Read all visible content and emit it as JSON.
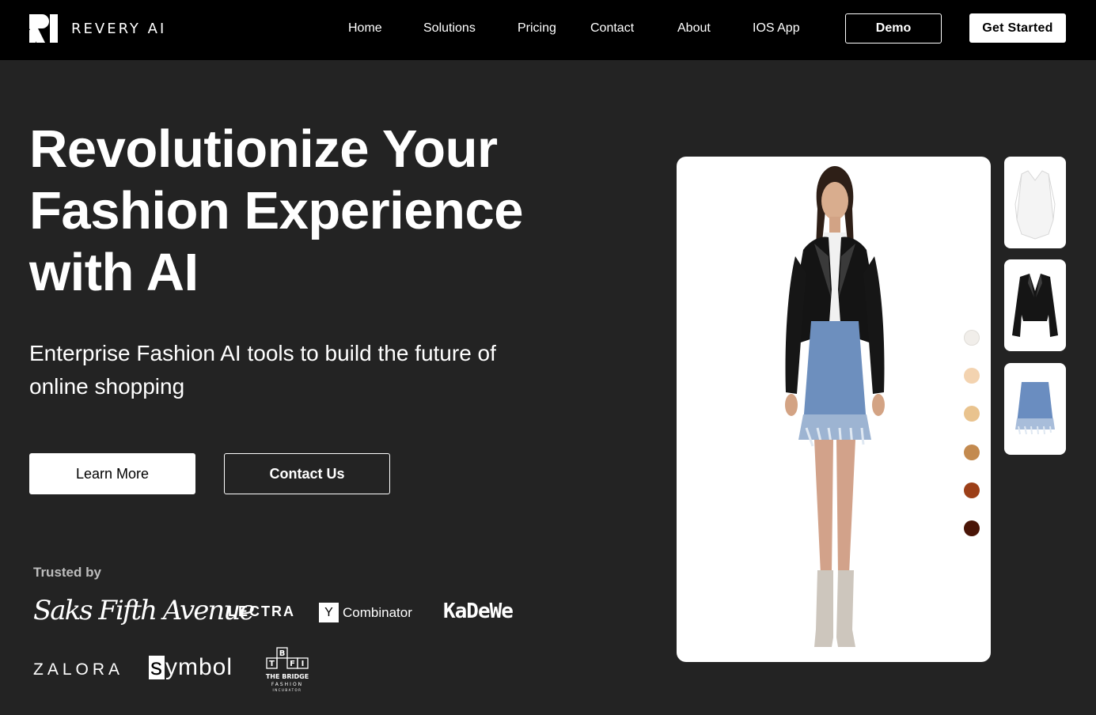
{
  "nav": {
    "brand": "REVERY AI",
    "links": [
      "Home",
      "Solutions",
      "Pricing",
      "Contact",
      "About",
      "IOS App"
    ],
    "demo_label": "Demo",
    "get_started_label": "Get Started"
  },
  "hero": {
    "headline": [
      "Revolutionize Your",
      "Fashion Experience",
      "with AI"
    ],
    "subline": [
      "Enterprise Fashion AI tools to build the future of",
      "online shopping"
    ],
    "learn_more_label": "Learn More",
    "contact_label": "Contact Us"
  },
  "trusted": {
    "label": "Trusted by",
    "brands": {
      "saks": "Saks Fifth Avenue",
      "lectra": "LECTRA",
      "yc_mark": "Y",
      "yc": "Combinator",
      "kadewe": "KaDeWe",
      "zalora": "ZALORA",
      "symbol_s": "s",
      "symbol_rest": "ymbol",
      "bridge": "THE BRIDGE FASHION INCUBATOR"
    }
  },
  "product": {
    "swatch_colors": [
      "#f1eeea",
      "#f3d3b0",
      "#e9c38e",
      "#c38a4f",
      "#9c3f18",
      "#4a1507"
    ],
    "thumbnails": [
      "white-corset-top",
      "black-leather-jacket",
      "blue-tweed-skirt"
    ]
  },
  "colors": {
    "background": "#232323",
    "nav_background": "#000000",
    "accent": "#ffffff"
  }
}
